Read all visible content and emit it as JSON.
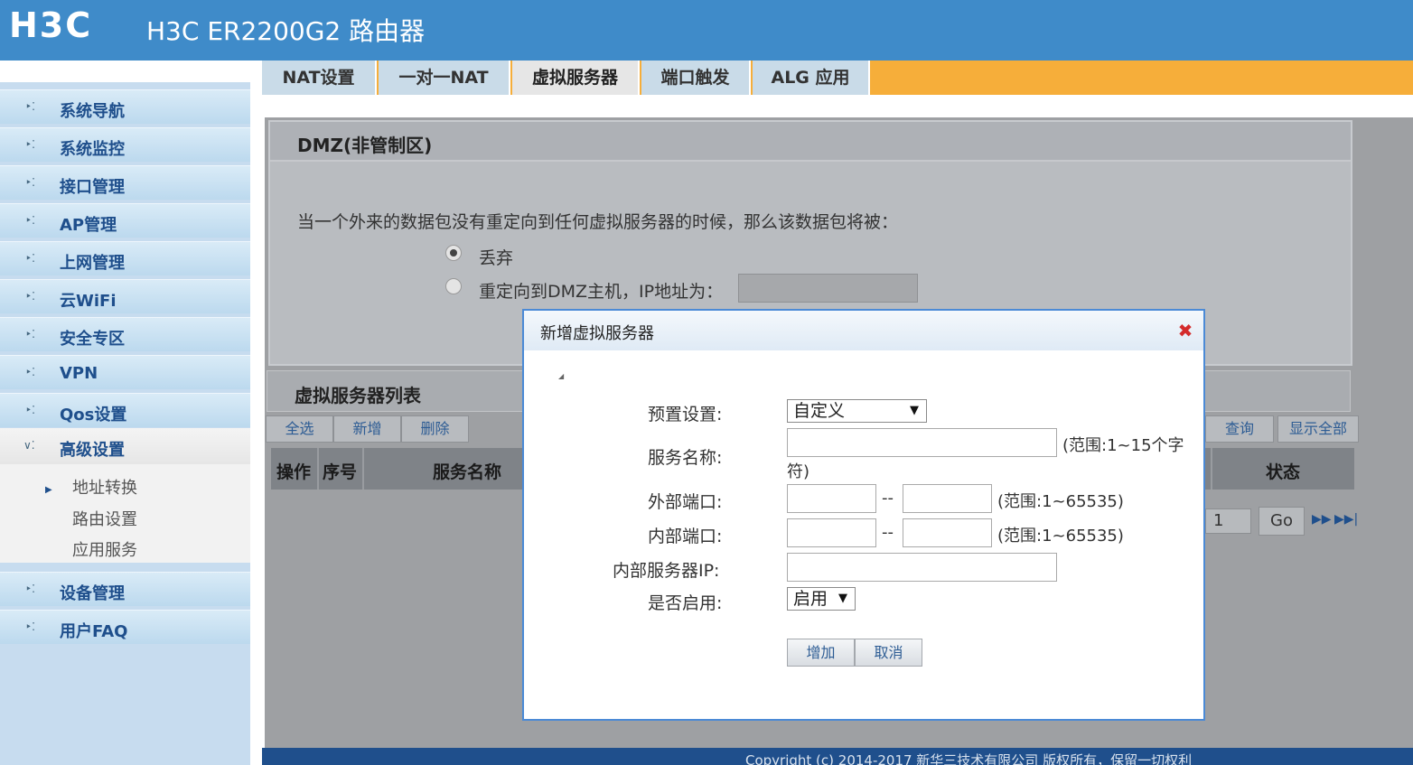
{
  "header": {
    "logo": "H3C",
    "title": "H3C ER2200G2 路由器"
  },
  "sidebar": {
    "items": [
      {
        "label": "系统导航"
      },
      {
        "label": "系统监控"
      },
      {
        "label": "接口管理"
      },
      {
        "label": "AP管理"
      },
      {
        "label": "上网管理"
      },
      {
        "label": "云WiFi"
      },
      {
        "label": "安全专区"
      },
      {
        "label": "VPN"
      },
      {
        "label": "Qos设置"
      }
    ],
    "expanded": {
      "label": "高级设置",
      "subitems": [
        {
          "label": "地址转换"
        },
        {
          "label": "路由设置"
        },
        {
          "label": "应用服务"
        }
      ]
    },
    "bottom_items": [
      {
        "label": "设备管理"
      },
      {
        "label": "用户FAQ"
      }
    ]
  },
  "tabs": [
    {
      "label": "NAT设置"
    },
    {
      "label": "一对一NAT"
    },
    {
      "label": "虚拟服务器",
      "active": true
    },
    {
      "label": "端口触发"
    },
    {
      "label": "ALG 应用"
    }
  ],
  "dmz": {
    "title": "DMZ(非管制区)",
    "description": "当一个外来的数据包没有重定向到任何虚拟服务器的时候，那么该数据包将被：",
    "option_drop": "丢弃",
    "option_redirect": "重定向到DMZ主机，IP地址为：",
    "selected": "丢弃",
    "ip_value": ""
  },
  "vs_list": {
    "title": "虚拟服务器列表",
    "buttons": {
      "select_all": "全选",
      "add": "新增",
      "delete": "删除",
      "query": "查询",
      "show_all": "显示全部"
    },
    "columns": [
      "操作",
      "序号",
      "服务名称",
      "状态"
    ],
    "page_number": "1",
    "go_label": "Go"
  },
  "footer": {
    "text": "Copyright (c) 2014-2017 新华三技术有限公司 版权所有，保留一切权利"
  },
  "modal": {
    "title": "新增虚拟服务器",
    "preset_label": "预置设置:",
    "preset_value": "自定义",
    "service_name_label": "服务名称:",
    "service_name_value": "",
    "service_name_hint": "(范围:1~15个字",
    "service_name_hint2": "符)",
    "ext_port_label": "外部端口:",
    "ext_port_from": "",
    "ext_port_to": "",
    "port_hint": "(范围:1~65535)",
    "int_port_label": "内部端口:",
    "int_port_from": "",
    "int_port_to": "",
    "server_ip_label": "内部服务器IP:",
    "server_ip_value": "",
    "enable_label": "是否启用:",
    "enable_value": "启用",
    "range_dash": "--",
    "add_button": "增加",
    "cancel_button": "取消"
  },
  "colors": {
    "header": "#3f8bc9",
    "tab_bar": "#f6ae3a",
    "footer": "#1f4f8c",
    "modal_border": "#4b8ad6",
    "close_icon": "#d42b2b"
  },
  "icons": {
    "nav_bullet": "arrow-dots-icon",
    "close": "close-icon",
    "next_page": "next-page-icon",
    "last_page": "last-page-icon",
    "dropdown": "chevron-down-icon"
  }
}
